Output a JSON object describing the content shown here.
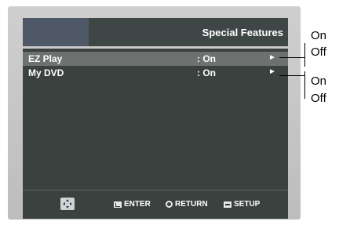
{
  "screen": {
    "title": "Special Features"
  },
  "menu": {
    "items": [
      {
        "label": "EZ Play",
        "value": ": On",
        "arrow": "►"
      },
      {
        "label": "My DVD",
        "value": ": On",
        "arrow": "►"
      }
    ]
  },
  "footer": {
    "enter_label": "ENTER",
    "return_label": "RETURN",
    "setup_label": "SETUP"
  },
  "callouts": {
    "ez_play_options": [
      "On",
      "Off"
    ],
    "my_dvd_options": [
      "On",
      "Off"
    ]
  },
  "colors": {
    "screen_bg": "#3a413f",
    "selected_row": "#6d7271",
    "text": "#ffffff"
  }
}
